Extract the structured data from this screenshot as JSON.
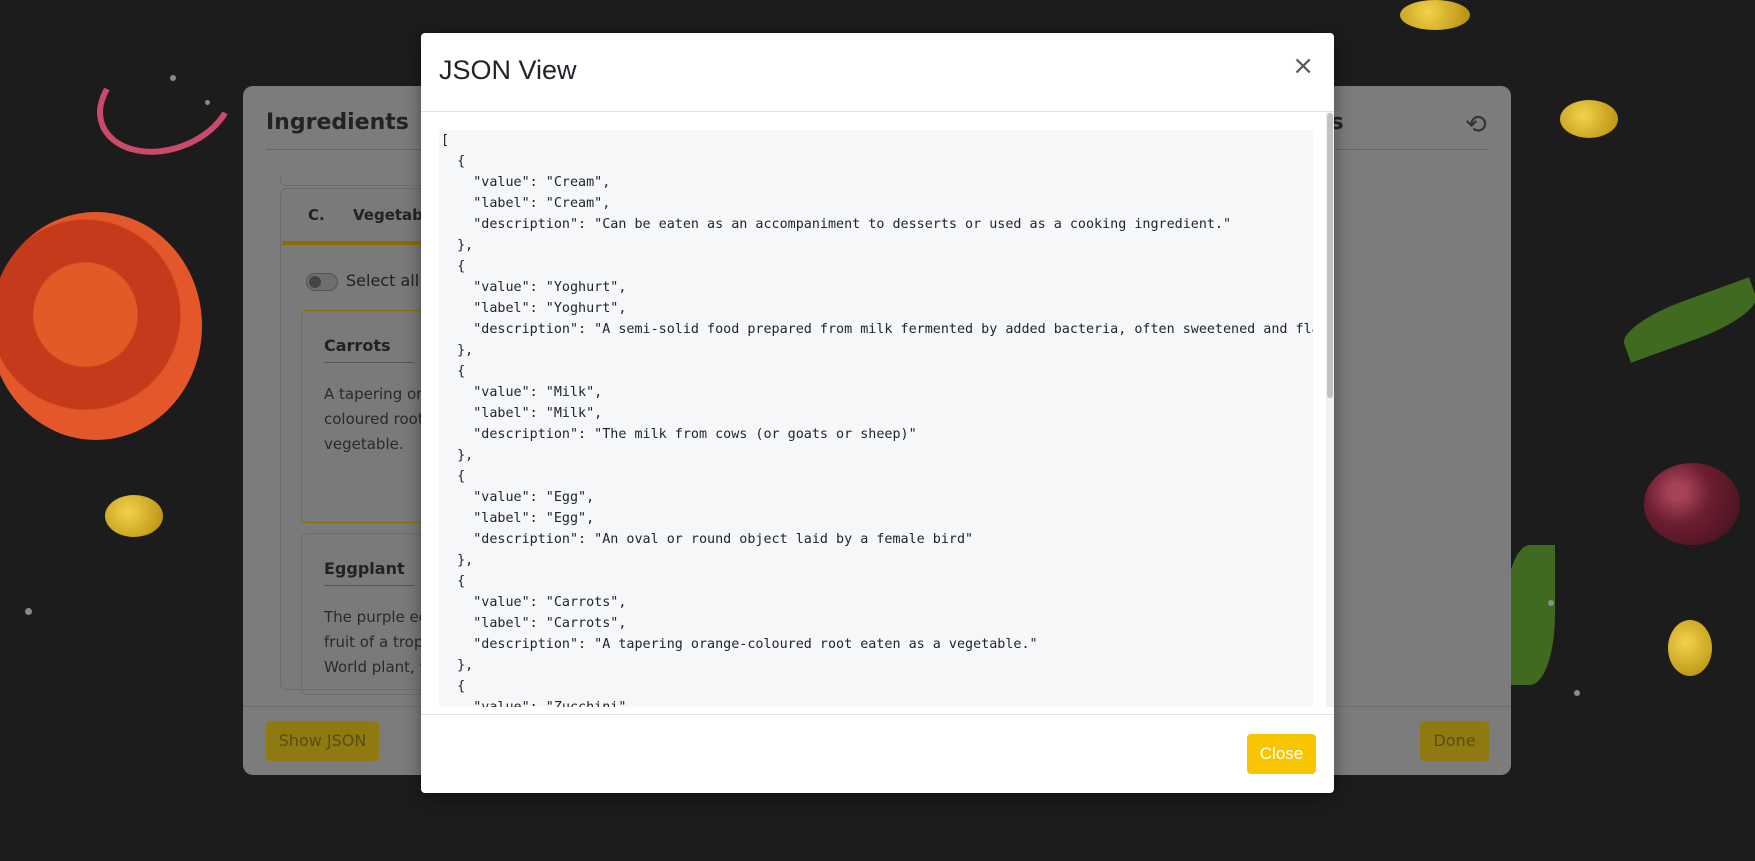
{
  "background_card": {
    "title_left": "Ingredients",
    "title_right_partial": "ts",
    "reset_icon": "reset-icon",
    "tabs": [
      "C.",
      "Vegetabl"
    ],
    "select_all_label": "Select all",
    "items": [
      {
        "title": "Carrots",
        "lines": [
          "A tapering or",
          "coloured root",
          "vegetable."
        ]
      },
      {
        "title": "Eggplant",
        "lines": [
          "The purple eg",
          "fruit of a trop",
          "World plant, w"
        ]
      }
    ],
    "show_json_label": "Show JSON",
    "done_label": "Done"
  },
  "modal": {
    "title": "JSON View",
    "close_icon": "close-icon",
    "close_button_label": "Close",
    "json_text": "[\n  {\n    \"value\": \"Cream\",\n    \"label\": \"Cream\",\n    \"description\": \"Can be eaten as an accompaniment to desserts or used as a cooking ingredient.\"\n  },\n  {\n    \"value\": \"Yoghurt\",\n    \"label\": \"Yoghurt\",\n    \"description\": \"A semi-solid food prepared from milk fermented by added bacteria, often sweetened and flav\n  },\n  {\n    \"value\": \"Milk\",\n    \"label\": \"Milk\",\n    \"description\": \"The milk from cows (or goats or sheep)\"\n  },\n  {\n    \"value\": \"Egg\",\n    \"label\": \"Egg\",\n    \"description\": \"An oval or round object laid by a female bird\"\n  },\n  {\n    \"value\": \"Carrots\",\n    \"label\": \"Carrots\",\n    \"description\": \"A tapering orange-coloured root eaten as a vegetable.\"\n  },\n  {\n    \"value\": \"Zucchini\","
  },
  "colors": {
    "accent": "#f7c600",
    "modal_bg": "#ffffff",
    "code_bg": "#f6f7f9"
  }
}
